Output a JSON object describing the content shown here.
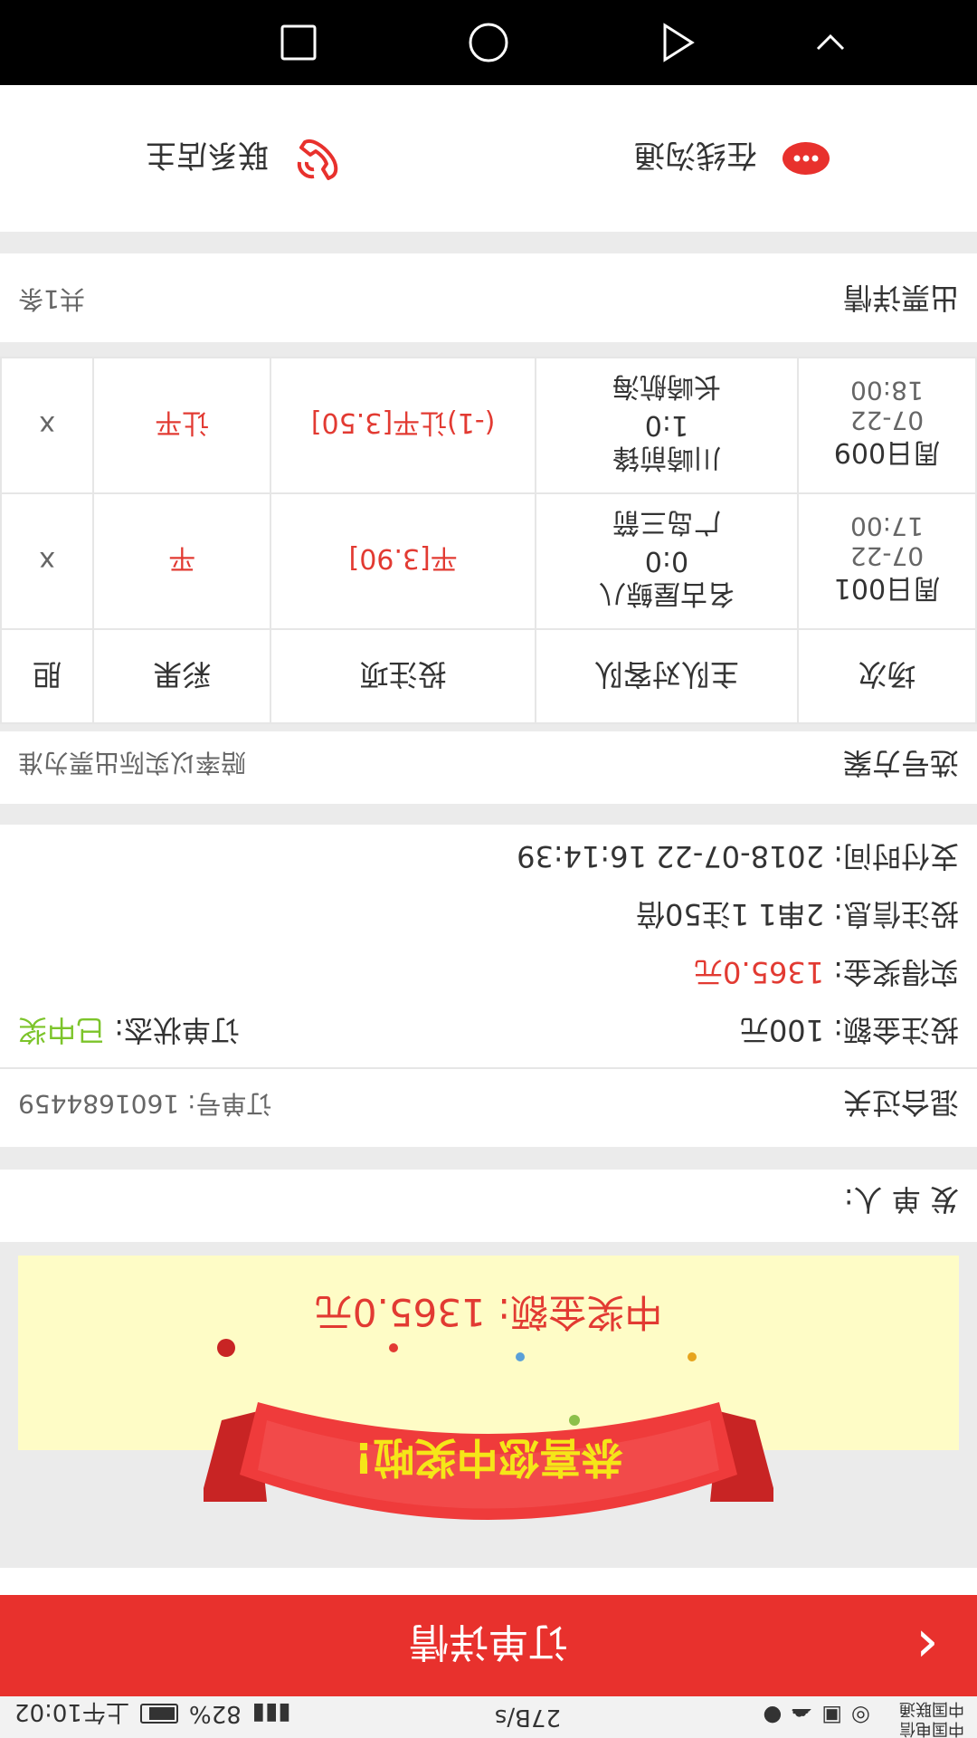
{
  "status_bar": {
    "carrier1": "中国电信",
    "carrier2": "中国联通",
    "speed": "27B/s",
    "battery": "82%",
    "time": "上午10:02"
  },
  "header": {
    "title": "订单详情",
    "back_icon": "chevron-left-icon"
  },
  "tabs_peek": [
    "",
    "",
    "",
    ""
  ],
  "banner": {
    "ribbon_text": "恭喜您中奖啦!",
    "prize_text": "中奖金额: 1365.0元"
  },
  "issuer": {
    "label": "发 单 人:"
  },
  "order": {
    "title": "混合过关",
    "order_no": "订单号: 1601684459",
    "bet_amount": "投注金额: 100元",
    "status_label": "订单状态: ",
    "status_value": "已中奖",
    "win_label": "实得奖金: ",
    "win_value": "1365.0元",
    "bet_info": "投注信息: 2串1 1注50倍",
    "pay_time": "支付时间: 2018-07-22 16:14:39"
  },
  "selection": {
    "title": "选号方案",
    "note": "赔率以实际出票为准",
    "headers": [
      "场次",
      "主队对客队",
      "投注项",
      "彩果",
      "胆"
    ],
    "rows": [
      {
        "match": [
          "周日001",
          "07-22",
          "17:00"
        ],
        "teams": [
          "名古屋鲸八",
          "0:0",
          "广岛三箭"
        ],
        "bet": "平[3.90]",
        "result": "平",
        "dan": "x"
      },
      {
        "match": [
          "周日009",
          "07-22",
          "18:00"
        ],
        "teams": [
          "川崎前锋",
          "1:0",
          "长崎航海"
        ],
        "bet": "(-1)让平[3.50]",
        "result": "让平",
        "dan": "x"
      }
    ]
  },
  "ticket": {
    "title": "出票详情",
    "count": "共1条"
  },
  "contact": {
    "online": "在线沟通",
    "owner": "联系店主"
  },
  "colors": {
    "accent": "#e8312d",
    "win": "#e23a32",
    "status": "#7cc42a",
    "banner": "#fefcc6"
  }
}
